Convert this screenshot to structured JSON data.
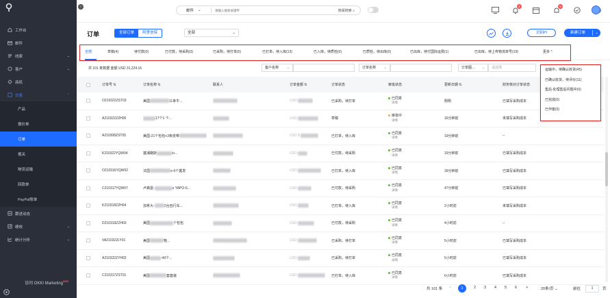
{
  "sidebar": {
    "items": [
      {
        "label": "工作台",
        "icon": "home-icon"
      },
      {
        "label": "邮件",
        "icon": "mail-icon"
      },
      {
        "label": "线索",
        "icon": "lead-icon",
        "arrow": "⌄"
      },
      {
        "label": "客户",
        "icon": "customer-icon",
        "arrow": "⌄"
      },
      {
        "label": "商机",
        "icon": "opportunity-icon"
      },
      {
        "label": "交易",
        "icon": "deal-icon",
        "arrow": "⌃"
      }
    ],
    "sub_items": [
      "产品",
      "报价单",
      "订单",
      "报关",
      "物流运输",
      "回款单",
      "PayPal账单"
    ],
    "more_items": [
      {
        "label": "跟进动态",
        "icon": "activity-icon"
      },
      {
        "label": "绩效",
        "icon": "performance-icon",
        "arrow": "⌄"
      },
      {
        "label": "统计分析",
        "icon": "analytics-icon",
        "arrow": "⌄"
      }
    ],
    "footer_text": "访问 OKKI Marketing",
    "footer_badge": "NEW"
  },
  "topbar": {
    "search_type": "邮件",
    "search_placeholder": "请输入搜索关键字",
    "search_mode": "简易搜索",
    "badges": {
      "bell": "2",
      "notify": "5"
    }
  },
  "header": {
    "title": "订单",
    "seg_all": "全部订单",
    "seg_other": "阿里信保",
    "scope": "全部",
    "btn_flow": "识别PI",
    "btn_new": "新建订单"
  },
  "tabs": [
    "全部",
    "草稿(4)",
    "待付款(0)",
    "已付款，待采购(3)",
    "已采购，待打单(5)",
    "已打单，待入库(13)",
    "已入库，待质检(0)",
    "已质检，待出库(0)",
    "已出库，待付国际运费(1)",
    "已出库，待上传物流单号(19)",
    "更多 ^"
  ],
  "filter": {
    "summary": "共 101 条数据  金额 USD 31,224.16",
    "f1": "客户名称",
    "f2": "订单名称",
    "f3": "订单图...",
    "f3_placeholder": "请选择"
  },
  "columns": [
    "订单号",
    "订单名称",
    "联系人",
    "订单金额",
    "订单状态",
    "审批状态",
    "更新日期",
    "财务核对订单状态"
  ],
  "rows": [
    {
      "no": "O210322ZST03",
      "name": "美国",
      "name2": "11条牛...",
      "amount": "USD",
      "status": "已采购，待打单",
      "appr": "已同意",
      "appr_color": "#52c41a",
      "appr_sub": "详情",
      "date": "刚刚",
      "fin": "已填写采购成本"
    },
    {
      "no": "A210322ZZH05",
      "name": "",
      "name2": "17个1 个...",
      "amount": "USD",
      "status": "草稿",
      "appr": "审批中",
      "appr_color": "#faad14",
      "appr_sub": "详情",
      "date": "16分钟前",
      "fin": "未填写采购成本"
    },
    {
      "no": "A210308ZST05",
      "name": "美国-21个包包+3条皮带",
      "name2": "",
      "amount": "USD 8",
      "status": "已打单，待入库",
      "appr": "已同意",
      "appr_color": "#52c41a",
      "appr_sub": "详情",
      "date": "19分钟前",
      "fin": "--"
    },
    {
      "no": "K210322YQW04",
      "name": "塞浦路斯",
      "name2": "io...",
      "amount": "USD",
      "status": "已付款，待采购",
      "appr": "已同意",
      "appr_color": "#52c41a",
      "appr_sub": "详情",
      "date": "19分钟前",
      "fin": "已填写采购成本"
    },
    {
      "no": "O210316YQW02",
      "name": "法国",
      "name2": "e-6个握发",
      "amount": "USD",
      "status": "已打单，待入库",
      "appr": "已同意",
      "appr_color": "#52c41a",
      "appr_sub": "详情",
      "date": "39分钟前",
      "fin": "已填写采购成本"
    },
    {
      "no": "C210317YQW07",
      "name": "卢森堡-",
      "name2": "e YAPO-6...",
      "amount": "USD",
      "status": "已付款，待采购",
      "appr": "已同意",
      "appr_color": "#52c41a",
      "appr_sub": "详情",
      "date": "47分钟前",
      "fin": "已填写采购成本"
    },
    {
      "no": "K210318ZZH04",
      "name": "加拿大-",
      "name2": "2台自行车...",
      "amount": "USD",
      "status": "已打单，待入库",
      "appr": "已同意",
      "appr_color": "#52c41a",
      "appr_sub": "详情",
      "date": "2小时前",
      "fin": "未填写采购成本"
    },
    {
      "no": "D210319ZZH03",
      "name": "美国",
      "name2": "个包包",
      "amount": "USD",
      "status": "已付款，待采购",
      "appr": "已同意",
      "appr_color": "#52c41a",
      "appr_sub": "详情",
      "date": "4小时前",
      "fin": "--"
    },
    {
      "no": "VA210322LY01",
      "name": "美国",
      "name2": "鞋...",
      "amount": "USD",
      "status": "已采购，待打单",
      "appr": "已同意",
      "appr_color": "#52c41a",
      "appr_sub": "详情",
      "date": "5小时前",
      "fin": "已填写采购成本"
    },
    {
      "no": "A210322ZYH02",
      "name": "美国",
      "name2": "-40个...",
      "amount": "USD",
      "status": "已采购，待打单",
      "appr": "已同意",
      "appr_color": "#52c41a",
      "appr_sub": "详情",
      "date": "5小时前",
      "fin": "已填写采购成本"
    },
    {
      "no": "C210317ZST01",
      "name": "美国",
      "name2": "套套装",
      "amount": "USD",
      "status": "已打单，待入库",
      "appr": "已同意",
      "appr_color": "#52c41a",
      "appr_sub": "详情",
      "date": "6小时前",
      "fin": "已填写采购成本"
    }
  ],
  "dropdown": [
    "运输中，待确认收货(45)",
    "已确认收货，待评价(11)",
    "售后-处理售后问题中(0)",
    "已完成(0)",
    "已作废(0)"
  ],
  "pager": {
    "total": "共 101 条",
    "prev": "<",
    "pages": [
      "1",
      "2",
      "3",
      "4",
      "5",
      "6"
    ],
    "next": ">",
    "size": "20条/页",
    "goto": "前往",
    "goto_value": "1",
    "page_unit": "页"
  },
  "colors": {
    "accent": "#1e6bff",
    "sidebar": "#2b2f3a",
    "highlight": "#e02020"
  }
}
